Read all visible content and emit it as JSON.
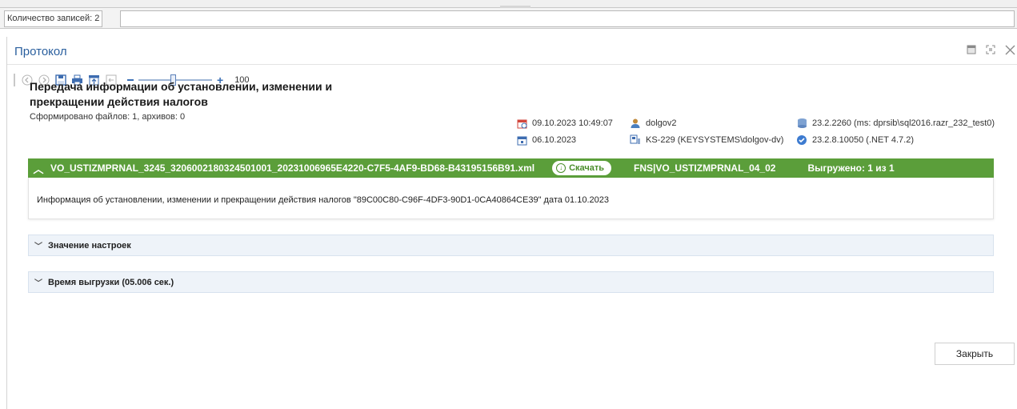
{
  "status": {
    "records_label": "Количество записей: 2"
  },
  "panel": {
    "title": "Протокол"
  },
  "toolbar": {
    "zoom_value": "100"
  },
  "report": {
    "title": "Передача информации об установлении, изменении и прекращении действия налогов",
    "subtitle": "Сформировано файлов: 1, архивов: 0",
    "datetime": "09.10.2023 10:49:07",
    "date": "06.10.2023",
    "user": "dolgov2",
    "machine": "KS-229 (KEYSYSTEMS\\dolgov-dv)",
    "db_version": "23.2.2260 (ms: dprsib\\sql2016.razr_232_test0)",
    "app_version": "23.2.8.10050 (.NET 4.7.2)"
  },
  "file": {
    "name": "VO_USTIZMPRNAL_3245_3206002180324501001_20231006965E4220-C7F5-4AF9-BD68-B43195156B91.xml",
    "download_label": "Скачать",
    "format": "FNS|VO_USTIZMPRNAL_04_02",
    "exported": "Выгружено: 1 из 1",
    "description": "Информация об установлении, изменении и прекращении действия налогов \"89C00C80-C96F-4DF3-90D1-0CA40864CE39\" дата 01.10.2023"
  },
  "sections": {
    "settings": "Значение настроек",
    "export_time": "Время выгрузки (05.006 сек.)"
  },
  "buttons": {
    "close": "Закрыть"
  },
  "colors": {
    "accent": "#5b9e3a",
    "title_blue": "#2a5f9e",
    "section_bg": "#eef3f9"
  }
}
